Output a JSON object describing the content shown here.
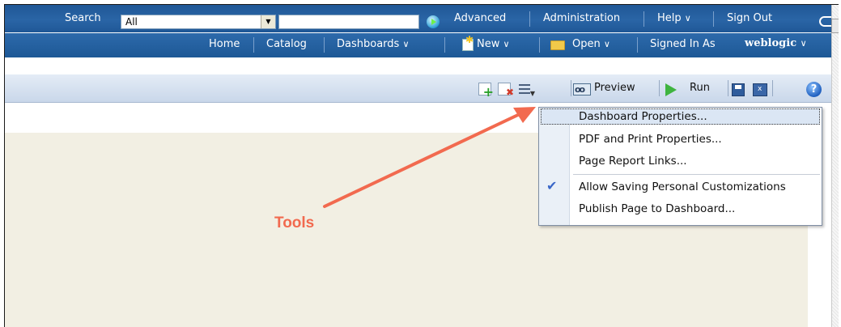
{
  "top_bar": {
    "search_label": "Search",
    "scope_value": "All",
    "search_value": "",
    "advanced": "Advanced",
    "administration": "Administration",
    "help": "Help",
    "sign_out": "Sign Out"
  },
  "nav_bar": {
    "home": "Home",
    "catalog": "Catalog",
    "dashboards": "Dashboards",
    "new": "New",
    "open": "Open",
    "signed_in_as": "Signed In As",
    "user": "weblogic"
  },
  "toolbar": {
    "preview": "Preview",
    "run": "Run",
    "help_glyph": "?"
  },
  "tools_menu": {
    "items": [
      "Dashboard Properties...",
      "PDF and Print Properties...",
      "Page Report Links...",
      "Allow Saving Personal Customizations",
      "Publish Page to Dashboard..."
    ],
    "checked_item": "Allow Saving Personal Customizations",
    "highlighted_item": "Dashboard Properties..."
  },
  "annotation": {
    "label": "Tools",
    "color": "#f26a4f"
  },
  "colors": {
    "header_blue": "#1f5796",
    "toolbar_light": "#dbe6f4",
    "canvas_beige": "#f2efe3"
  }
}
